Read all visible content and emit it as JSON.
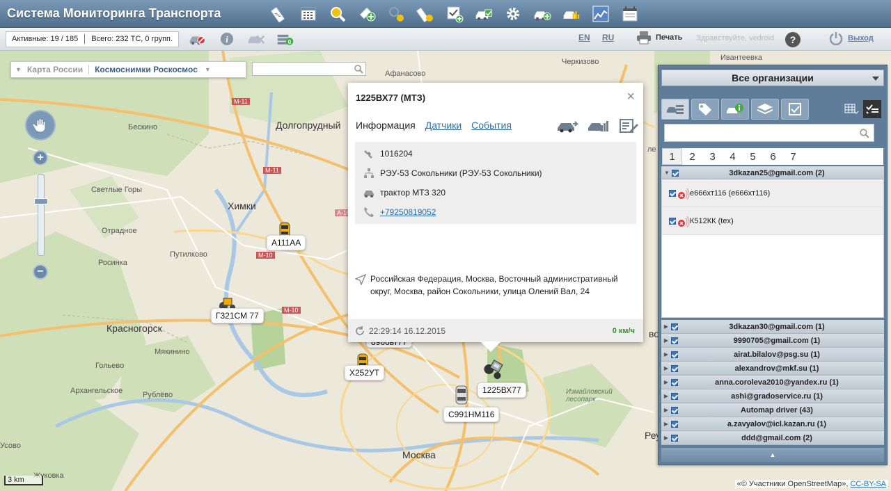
{
  "app": {
    "title": "Система Мониторинга Транспорта"
  },
  "status": {
    "active": "Активные: 19 / 185",
    "total": "Всего: 232 ТС, 0 групп."
  },
  "header": {
    "lang_en": "EN",
    "lang_ru": "RU",
    "print": "Печать",
    "greeting": "Здравствуйте, vedroid",
    "help": "?",
    "exit": "Выход"
  },
  "map": {
    "type_russia": "Карта России",
    "type_satellite": "Космоснимки Роскосмос",
    "search_placeholder": "",
    "scale": "3 km",
    "attribution_text": "«© Участники OpenStreetMap»,",
    "attribution_link": "CC-BY-SA",
    "places": {
      "cherkizovo": "Черкизово",
      "ivanteevka": "Ивантеевка",
      "afanasovo": "Афанасово",
      "dolgoprudny": "Долгопрудный",
      "beskino": "Бескино",
      "khimki": "Химки",
      "svetlye_gory": "Светлые Горы",
      "otradnoe": "Отрадное",
      "putilkovo": "Путилково",
      "rosinka": "Росинка",
      "krasnogorsk": "Красногорск",
      "myakinino": "Мякинино",
      "golyevo": "Гольево",
      "arkhangelskoe": "Архангельское",
      "rublevo": "Рублёво",
      "usovo": "Усово",
      "zhukovka": "Жуковка",
      "moskva": "Москва",
      "izmailovo": "Измайловский лесопарк",
      "m11a": "М-11",
      "m11b": "М-11",
      "m10a": "М-10",
      "m10b": "М-10",
      "a10": "А-10",
      "rev": "Реу",
      "vo": "во",
      "lsub": "ле"
    }
  },
  "vehicles": [
    {
      "plate": "А111АА"
    },
    {
      "plate": "Г321СМ"
    },
    {
      "plate": "77"
    },
    {
      "plate": "8966вт77"
    },
    {
      "plate": "Х252УТ"
    },
    {
      "plate": "1225ВХ77"
    },
    {
      "plate": "С991НМ116"
    }
  ],
  "popup": {
    "title": "1225ВХ77 (МТЗ)",
    "tab_info": "Информация",
    "tab_sensors": "Датчики",
    "tab_events": "События",
    "id": "1016204",
    "org": "РЭУ-53 Сокольники (РЭУ-53 Сокольники)",
    "model": "трактор МТЗ 320",
    "phone": "+79250819052",
    "address": "Российская Федерация, Москва, Восточный административный округ, Москва, район Сокольники, улица Олений Вал, 24",
    "time": "22:29:14 16.12.2015",
    "speed": "0 км/ч",
    "close": "×"
  },
  "panel": {
    "org_select": "Все организации",
    "search_placeholder": "",
    "pages": [
      "1",
      "2",
      "3",
      "4",
      "5",
      "6",
      "7"
    ],
    "open_group": {
      "name": "3dkazan25@gmail.com (2)",
      "items": [
        "е666хт116 (е666хт116)",
        "К512КК (tex)"
      ]
    },
    "groups": [
      "3dkazan30@gmail.com (1)",
      "9990705@gmail.com (1)",
      "airat.bilalov@psg.su (1)",
      "alexandrov@mkf.su (1)",
      "anna.coroleva2010@yandex.ru (1)",
      "ashi@gradoservice.ru (1)",
      "Automap driver (43)",
      "a.zavyalov@icl.kazan.ru (1)",
      "ddd@gmail.com (2)"
    ]
  },
  "colors": {
    "toolbar": "#5f7d99",
    "link": "#2d6fa8",
    "speed": "#3a8a3a",
    "accent_yellow": "#f2c200"
  }
}
